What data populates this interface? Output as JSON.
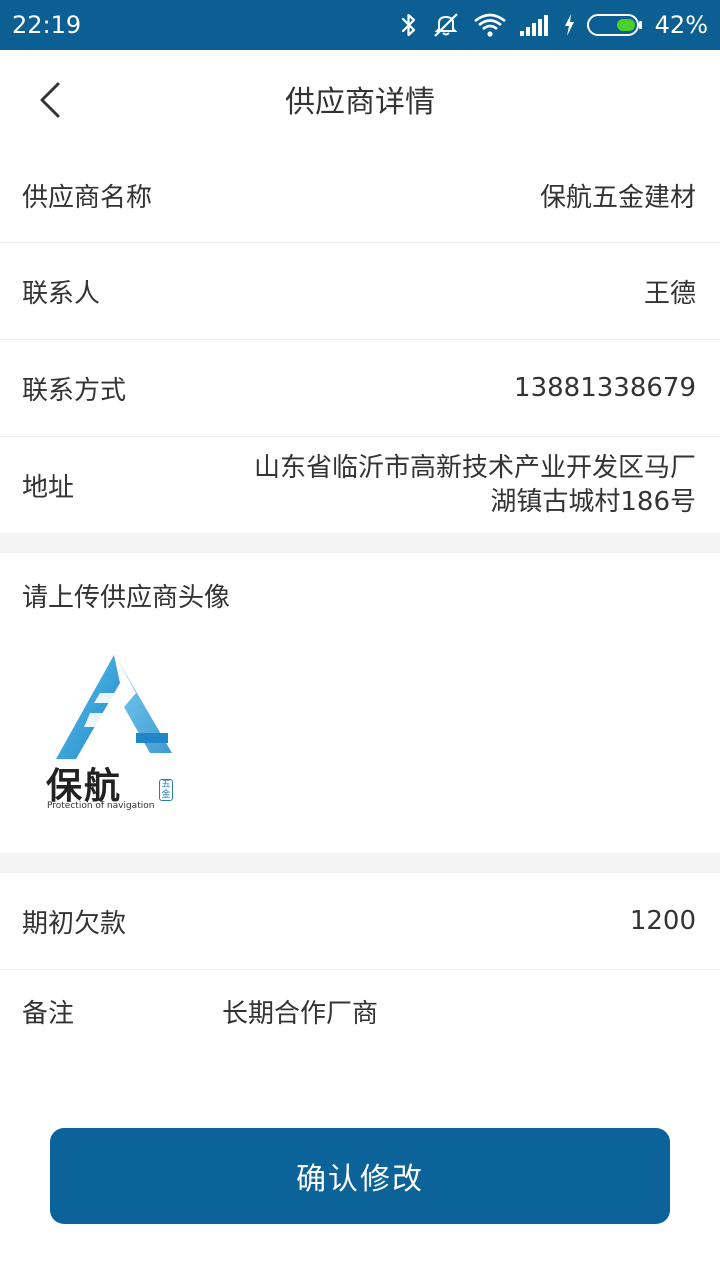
{
  "status_bar": {
    "time": "22:19",
    "battery_percent": "42%",
    "battery_level": 0.42
  },
  "header": {
    "title": "供应商详情"
  },
  "fields": {
    "supplier_name": {
      "label": "供应商名称",
      "value": "保航五金建材"
    },
    "contact_person": {
      "label": "联系人",
      "value": "王德"
    },
    "contact_method": {
      "label": "联系方式",
      "value": "13881338679"
    },
    "address": {
      "label": "地址",
      "value_line1": "山东省临沂市高新技术产业开发区马厂",
      "value_line2": "湖镇古城村186号"
    }
  },
  "upload": {
    "title": "请上传供应商头像",
    "logo_text_cn": "保航",
    "logo_text_en": "Protection of navigation",
    "logo_stamp": "五金"
  },
  "finance": {
    "opening_debt": {
      "label": "期初欠款",
      "value": "1200"
    },
    "remark": {
      "label": "备注",
      "value": "长期合作厂商"
    }
  },
  "actions": {
    "confirm_label": "确认修改"
  },
  "colors": {
    "primary": "#0b6399",
    "status_bar": "#0b5f93",
    "battery_fill": "#4cd12a"
  }
}
